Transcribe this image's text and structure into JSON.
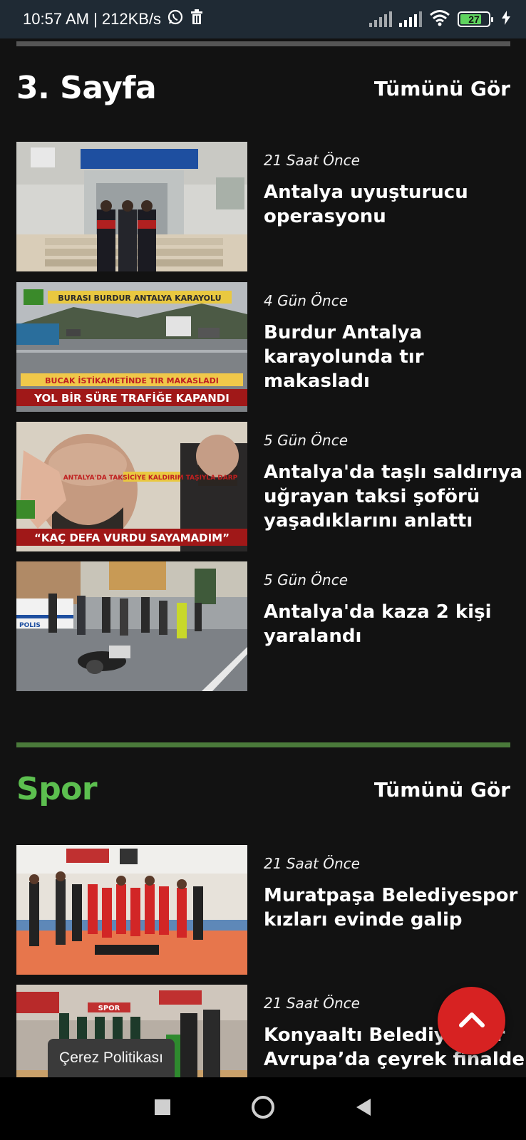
{
  "status_bar": {
    "time_speed": "10:57 AM | 212KB/s",
    "battery": "27"
  },
  "sections": [
    {
      "title": "3. Sayfa",
      "see_all": "Tümünü Gör",
      "title_color": "#ffffff",
      "divider_color": "#555555",
      "items": [
        {
          "time": "21 Saat Önce",
          "headline": "Antalya uyuşturucu operasyonu",
          "image": "jandarma-building-photo"
        },
        {
          "time": "4 Gün Önce",
          "headline": "Burdur Antalya karayolunda tır makasladı",
          "image": "highway-truck-photo",
          "overlay": {
            "top_label": "BURASI BURDUR ANTALYA KARAYOLU",
            "mid_label": "BUCAK İSTİKAMETİNDE TIR MAKASLADI",
            "bottom_label": "YOL BİR SÜRE TRAFİĞE KAPANDI"
          }
        },
        {
          "time": "5 Gün Önce",
          "headline": "Antalya'da taşlı saldırıya uğrayan taksi şoförü yaşadıklarını anlattı",
          "image": "injured-driver-photo",
          "overlay": {
            "mid_label": "ANTALYA'DA TAKSİCİYE KALDIRIM TAŞIYLA DARP",
            "bottom_label": "“KAÇ DEFA VURDU SAYAMADIM”"
          }
        },
        {
          "time": "5 Gün Önce",
          "headline": "Antalya'da kaza 2 kişi yaralandı",
          "image": "accident-scene-photo",
          "overlay": {
            "police_label": "POLIS"
          }
        }
      ]
    },
    {
      "title": "Spor",
      "see_all": "Tümünü Gör",
      "title_color": "#5cbf4f",
      "divider_color": "#4a7a3a",
      "items": [
        {
          "time": "21 Saat Önce",
          "headline": "Muratpaşa Belediyespor kızları evinde galip",
          "image": "volleyball-team-photo"
        },
        {
          "time": "21 Saat Önce",
          "headline": "Konyaaltı Belediyespor Avrupa’da çeyrek finalde",
          "image": "team-celebration-photo",
          "overlay": {
            "label": "SPOR"
          }
        }
      ]
    }
  ],
  "cookie_banner": "Çerez Politikası",
  "colors": {
    "background": "#121212",
    "fab": "#d72222",
    "accent_green": "#5cbf4f"
  }
}
